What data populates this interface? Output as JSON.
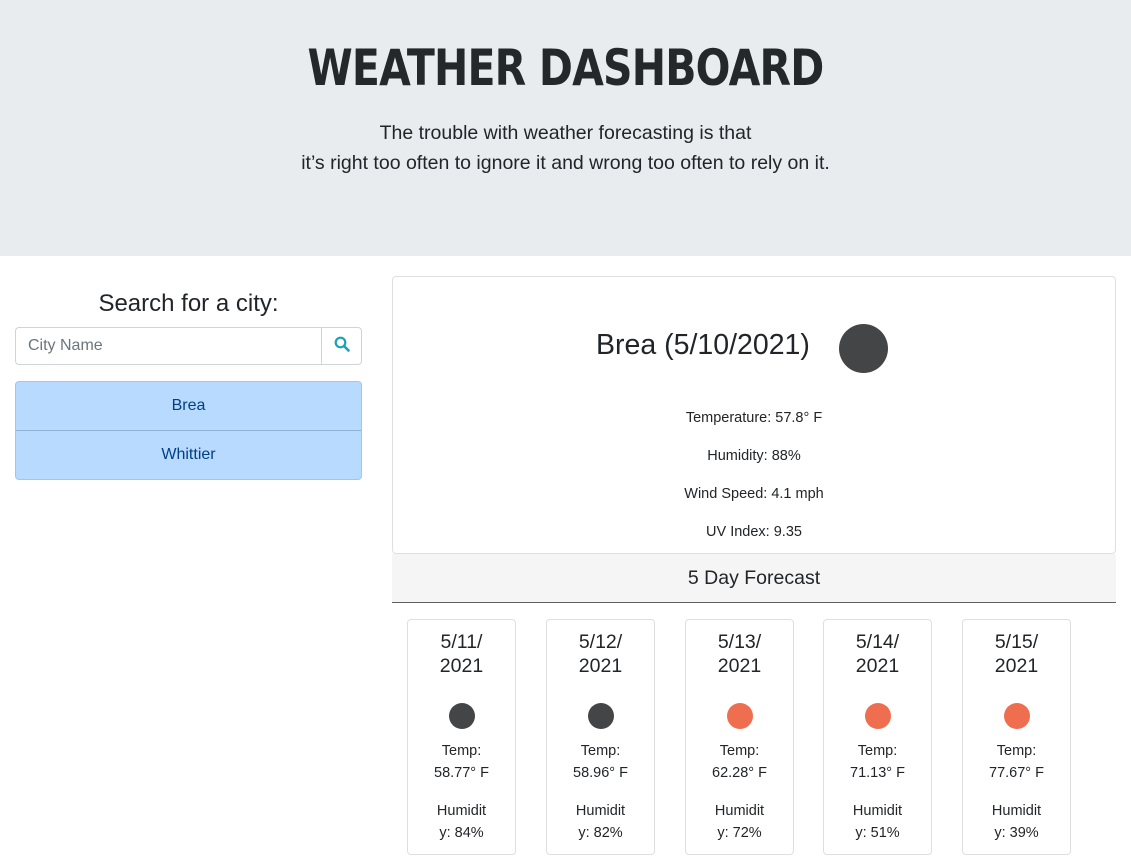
{
  "header": {
    "title": "WEATHER DASHBOARD",
    "quote_line1": "The trouble with weather forecasting is that",
    "quote_line2": "it’s right too often to ignore it and wrong too often to rely on it."
  },
  "search": {
    "heading": "Search for a city:",
    "placeholder": "City Name",
    "value": "",
    "button_icon": "search-icon"
  },
  "history": [
    {
      "label": "Brea"
    },
    {
      "label": "Whittier"
    }
  ],
  "current": {
    "title": "Brea (5/10/2021)",
    "icon": "weather-icon",
    "temperature": "Temperature: 57.8° F",
    "humidity": "Humidity: 88%",
    "wind": "Wind Speed: 4.1 mph",
    "uv": "UV Index: 9.35"
  },
  "forecast": {
    "heading": "5 Day Forecast",
    "days": [
      {
        "date": "5/11/\n2021",
        "icon_color": "#444546",
        "temp": "Temp:\n58.77° F",
        "humidity": "Humidit\ny: 84%"
      },
      {
        "date": "5/12/\n2021",
        "icon_color": "#444546",
        "temp": "Temp:\n58.96° F",
        "humidity": "Humidit\ny: 82%"
      },
      {
        "date": "5/13/\n2021",
        "icon_color": "#ee6e4f",
        "temp": "Temp:\n62.28° F",
        "humidity": "Humidit\ny: 72%"
      },
      {
        "date": "5/14/\n2021",
        "icon_color": "#ee6e4f",
        "temp": "Temp:\n71.13° F",
        "humidity": "Humidit\ny: 51%"
      },
      {
        "date": "5/15/\n2021",
        "icon_color": "#ee6e4f",
        "temp": "Temp:\n77.67° F",
        "humidity": "Humidit\ny: 39%"
      }
    ]
  },
  "colors": {
    "hero_bg": "#e9ecef",
    "list_bg": "#b8daff",
    "list_text": "#004085",
    "search_icon": "#17a2b8"
  }
}
